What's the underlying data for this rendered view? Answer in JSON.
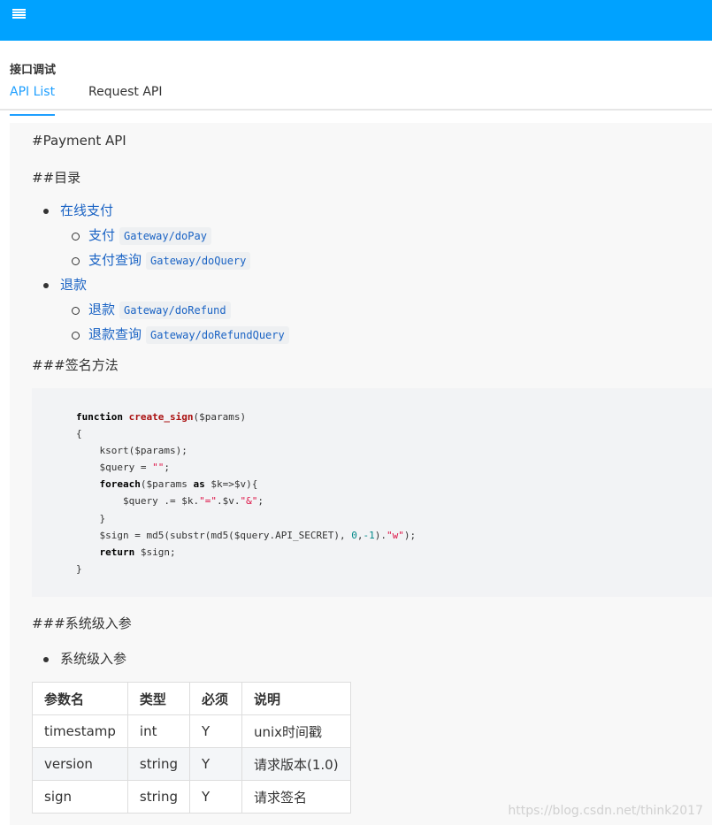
{
  "header": {
    "menu_icon": "hamburger-menu-icon",
    "bg_color": "#00a2ff"
  },
  "section": {
    "title": "接口调试"
  },
  "tabs": [
    {
      "label": "API List",
      "active": true
    },
    {
      "label": "Request API",
      "active": false
    }
  ],
  "doc": {
    "h1": "#Payment API",
    "toc_heading": "##目录",
    "toc": [
      {
        "label": "在线支付",
        "children": [
          {
            "label": "支付",
            "code": "Gateway/doPay"
          },
          {
            "label": "支付查询",
            "code": "Gateway/doQuery"
          }
        ]
      },
      {
        "label": "退款",
        "children": [
          {
            "label": "退款",
            "code": "Gateway/doRefund"
          },
          {
            "label": "退款查询",
            "code": "Gateway/doRefundQuery"
          }
        ]
      }
    ],
    "sign_heading": "###签名方法",
    "code_lines": [
      "function create_sign($params)",
      "{",
      "    ksort($params);",
      "    $query = \"\";",
      "    foreach($params as $k=>$v){",
      "        $query .= $k.\"=\".$v.\"&\";",
      "    }",
      "    $sign = md5(substr(md5($query.API_SECRET), 0,-1).\"w\");",
      "    return $sign;",
      "}"
    ],
    "params_heading": "###系统级入参",
    "params_bullet": "系统级入参",
    "table": {
      "headers": [
        "参数名",
        "类型",
        "必须",
        "说明"
      ],
      "rows": [
        [
          "timestamp",
          "int",
          "Y",
          "unix时间戳"
        ],
        [
          "version",
          "string",
          "Y",
          "请求版本(1.0)"
        ],
        [
          "sign",
          "string",
          "Y",
          "请求签名"
        ]
      ]
    }
  },
  "watermark": "https://blog.csdn.net/think2017"
}
